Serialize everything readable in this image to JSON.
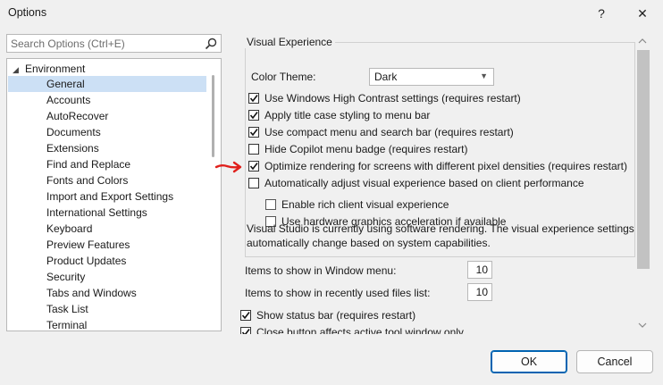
{
  "window": {
    "title": "Options",
    "help_glyph": "?",
    "close_glyph": "✕"
  },
  "search": {
    "placeholder": "Search Options (Ctrl+E)"
  },
  "tree": {
    "root_label": "Environment",
    "items": [
      {
        "label": "General",
        "selected": true
      },
      {
        "label": "Accounts"
      },
      {
        "label": "AutoRecover"
      },
      {
        "label": "Documents"
      },
      {
        "label": "Extensions"
      },
      {
        "label": "Find and Replace"
      },
      {
        "label": "Fonts and Colors"
      },
      {
        "label": "Import and Export Settings"
      },
      {
        "label": "International Settings"
      },
      {
        "label": "Keyboard"
      },
      {
        "label": "Preview Features"
      },
      {
        "label": "Product Updates"
      },
      {
        "label": "Security"
      },
      {
        "label": "Tabs and Windows"
      },
      {
        "label": "Task List"
      },
      {
        "label": "Terminal"
      }
    ]
  },
  "visual": {
    "group_title": "Visual Experience",
    "color_theme_label": "Color Theme:",
    "color_theme_value": "Dark",
    "options": [
      {
        "label": "Use Windows High Contrast settings (requires restart)",
        "checked": true
      },
      {
        "label": "Apply title case styling to menu bar",
        "checked": true
      },
      {
        "label": "Use compact menu and search bar (requires restart)",
        "checked": true
      },
      {
        "label": "Hide Copilot menu badge (requires restart)",
        "checked": false
      },
      {
        "label": "Optimize rendering for screens with different pixel densities (requires restart)",
        "checked": true
      },
      {
        "label": "Automatically adjust visual experience based on client performance",
        "checked": false
      }
    ],
    "sub_options": [
      {
        "label": "Enable rich client visual experience",
        "checked": false
      },
      {
        "label": "Use hardware graphics acceleration if available",
        "checked": false
      }
    ],
    "note": "Visual Studio is currently using software rendering.  The visual experience settings automatically change based on system capabilities."
  },
  "items_window_menu": {
    "label": "Items to show in Window menu:",
    "value": "10"
  },
  "items_recent_files": {
    "label": "Items to show in recently used files list:",
    "value": "10"
  },
  "bottom_options": [
    {
      "label": "Show status bar (requires restart)",
      "checked": true
    },
    {
      "label": "Close button affects active tool window only",
      "checked": true
    }
  ],
  "buttons": {
    "ok": "OK",
    "cancel": "Cancel"
  },
  "colors": {
    "selection": "#cce0f5",
    "annotation_arrow": "#e0201c",
    "primary_border": "#0063b1"
  }
}
